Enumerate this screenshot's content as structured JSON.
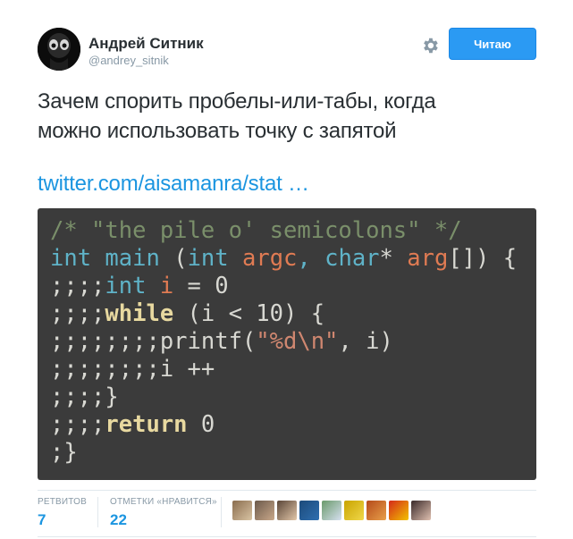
{
  "author": {
    "name": "Андрей Ситник",
    "handle": "@andrey_sitnik"
  },
  "actions": {
    "follow_label": "Читаю",
    "settings_icon": "gear-icon"
  },
  "tweet": {
    "text_line1": "Зачем спорить пробелы-или-табы, когда",
    "text_line2": "можно использовать точку с запятой",
    "link": "twitter.com/aisamanra/stat …"
  },
  "code_image": {
    "lines": [
      "/* \"the pile o' semicolons\" */",
      "int main (int argc, char* arg[]) {",
      ";;;;int i = 0",
      ";;;;while (i < 10) {",
      ";;;;;;;;printf(\"%d\\n\", i)",
      ";;;;;;;;i ++",
      ";;;;}",
      ";;;;return 0",
      ";}"
    ]
  },
  "stats": {
    "retweets_label": "РЕТВИТОВ",
    "retweets_value": "7",
    "likes_label": "ОТМЕТКИ «НРАВИТСЯ»",
    "likes_value": "22"
  },
  "colors": {
    "accent": "#1b95e0",
    "follow_button": "#2b9af3",
    "code_background": "#3b3b3b"
  }
}
